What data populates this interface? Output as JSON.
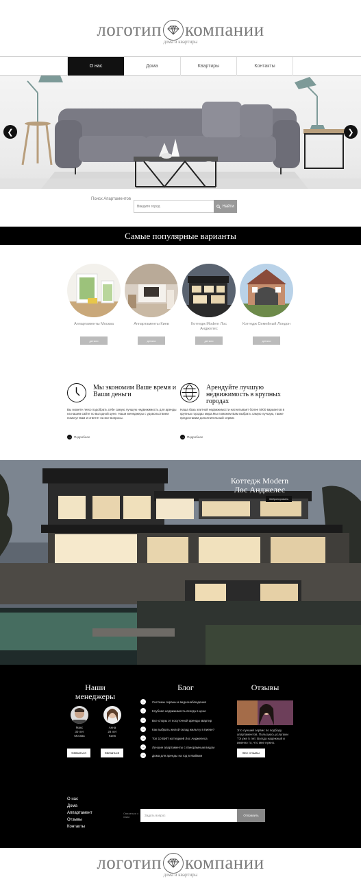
{
  "logo": {
    "word1": "логотип",
    "word2": "компании",
    "subtitle": "дома и квартиры"
  },
  "nav": [
    {
      "label": "О нас",
      "active": true
    },
    {
      "label": "Дома"
    },
    {
      "label": "Квартиры"
    },
    {
      "label": "Контакты"
    }
  ],
  "search": {
    "label": "Поиск Апартаментов",
    "placeholder": "Введите город",
    "button": "Найти"
  },
  "popular": {
    "title": "Самые популярные варианты",
    "items": [
      {
        "name": "Аппартаменты Москва",
        "button": "детали"
      },
      {
        "name": "Аппартаменты Киев",
        "button": "детали"
      },
      {
        "name": "Коттедж Modern Лос Анджелес",
        "button": "детали"
      },
      {
        "name": "Коттедж Семейный Лондон",
        "button": "детали"
      }
    ]
  },
  "features": [
    {
      "title": "Мы экономим Ваше время и Ваши деньги",
      "text": "Вы можете легко подобрать себе самую лучшую недвижимость для аренды на нашем сайте по выгодной цене. Наши менеджеры с удовольствием помогут Вам и ответят на все вопросы.",
      "more": "Подробнее",
      "icon": "clock-icon"
    },
    {
      "title": "Арендуйте лучшую недвижимость в крупных городах",
      "text": "Наша база элитной недвижимости насчитывает более 5000 вариантов в крупных городах мира.Мы поможем Вам выбрать самую лучшую, также предоставим дополнительный сервис",
      "more": "Подробнее",
      "icon": "globe-icon"
    }
  ],
  "featured": {
    "title": "Коттедж Modern Лос Анджелес",
    "button": "Забронировать"
  },
  "managers": {
    "title": "Наши менеджеры",
    "people": [
      {
        "name": "Макс",
        "age": "30 лет",
        "city": "Москва",
        "button": "Связаться"
      },
      {
        "name": "Анна",
        "age": "28 лет",
        "city": "Киев",
        "button": "Связаться"
      }
    ]
  },
  "blog": {
    "title": "Блог",
    "items": [
      "Системы охраны и видеонаблюдения",
      "Клубная недвижимость всегда в цене",
      "Все споры от посуточной аренды квартир",
      "Как выбрать жилой склад жилья у в Киеве?",
      "Топ 10 ВИП коттеджей Лос Анджелеса",
      "Лучшие апартаменты с панорамным видом",
      "Дома для аренды на год в Майами"
    ]
  },
  "reviews": {
    "title": "Отзывы",
    "text": "Это лучший сервис по подбору апартаментов. Пользуюсь услугами ТЭ уже 5 лет. Всегда надежный и именно то, что мне нужно.",
    "button": "Все отзывы"
  },
  "footer": {
    "links": [
      "О нас",
      "Дома",
      "Аппартамент",
      "Отзывы",
      "Контакты"
    ],
    "subscribe_label": "Связаться с нами",
    "subscribe_placeholder": "Задать вопрос",
    "subscribe_button": "Отправить"
  }
}
